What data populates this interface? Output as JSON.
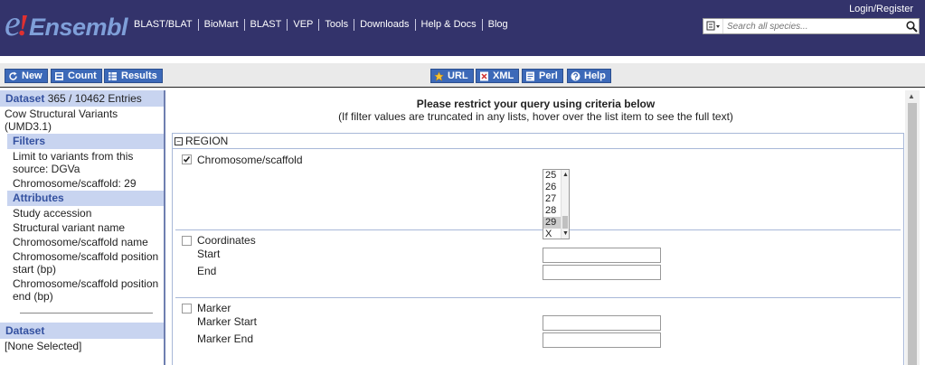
{
  "header": {
    "logo": {
      "e": "e",
      "bang": "!",
      "word": "Ensembl"
    },
    "nav": [
      "BLAST/BLAT",
      "BioMart",
      "BLAST",
      "VEP",
      "Tools",
      "Downloads",
      "Help & Docs",
      "Blog"
    ],
    "login": "Login/Register",
    "search_placeholder": "Search all species..."
  },
  "toolbar": {
    "new": "New",
    "count": "Count",
    "results": "Results",
    "url": "URL",
    "xml": "XML",
    "perl": "Perl",
    "help": "Help"
  },
  "sidebar": {
    "dataset_label": "Dataset",
    "dataset_count": "365 / 10462 Entries",
    "dataset_name": "Cow Structural Variants (UMD3.1)",
    "filters_label": "Filters",
    "filters": [
      "Limit to variants from this source: DGVa",
      "Chromosome/scaffold: 29"
    ],
    "attributes_label": "Attributes",
    "attributes": [
      "Study accession",
      "Structural variant name",
      "Chromosome/scaffold name",
      "Chromosome/scaffold position start (bp)",
      "Chromosome/scaffold position end (bp)"
    ],
    "dataset2_label": "Dataset",
    "dataset2_value": "[None Selected]"
  },
  "main": {
    "title": "Please restrict your query using criteria below",
    "subtitle": "(If filter values are truncated in any lists, hover over the list item to see the full text)",
    "region_label": "REGION",
    "region_toggle": "⊟",
    "chromosome": {
      "label": "Chromosome/scaffold",
      "checked": true,
      "options": [
        "25",
        "26",
        "27",
        "28",
        "29",
        "X"
      ],
      "selected": "29"
    },
    "coordinates": {
      "label": "Coordinates",
      "start": "Start",
      "end": "End"
    },
    "marker": {
      "label": "Marker",
      "start": "Marker Start",
      "end": "Marker End"
    }
  },
  "colors": {
    "masthead": "#33336b",
    "button": "#3c69b8",
    "sidebar_head": "#c8d4f0"
  }
}
